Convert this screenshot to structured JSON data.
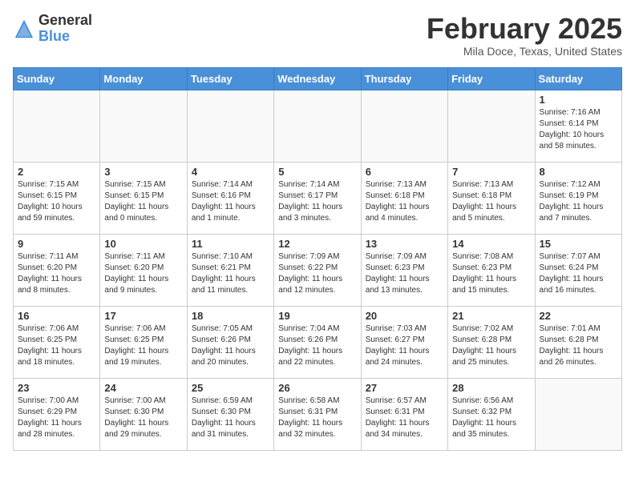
{
  "header": {
    "logo_general": "General",
    "logo_blue": "Blue",
    "month_title": "February 2025",
    "location": "Mila Doce, Texas, United States"
  },
  "days_of_week": [
    "Sunday",
    "Monday",
    "Tuesday",
    "Wednesday",
    "Thursday",
    "Friday",
    "Saturday"
  ],
  "weeks": [
    [
      {
        "day": "",
        "info": ""
      },
      {
        "day": "",
        "info": ""
      },
      {
        "day": "",
        "info": ""
      },
      {
        "day": "",
        "info": ""
      },
      {
        "day": "",
        "info": ""
      },
      {
        "day": "",
        "info": ""
      },
      {
        "day": "1",
        "info": "Sunrise: 7:16 AM\nSunset: 6:14 PM\nDaylight: 10 hours\nand 58 minutes."
      }
    ],
    [
      {
        "day": "2",
        "info": "Sunrise: 7:15 AM\nSunset: 6:15 PM\nDaylight: 10 hours\nand 59 minutes."
      },
      {
        "day": "3",
        "info": "Sunrise: 7:15 AM\nSunset: 6:15 PM\nDaylight: 11 hours\nand 0 minutes."
      },
      {
        "day": "4",
        "info": "Sunrise: 7:14 AM\nSunset: 6:16 PM\nDaylight: 11 hours\nand 1 minute."
      },
      {
        "day": "5",
        "info": "Sunrise: 7:14 AM\nSunset: 6:17 PM\nDaylight: 11 hours\nand 3 minutes."
      },
      {
        "day": "6",
        "info": "Sunrise: 7:13 AM\nSunset: 6:18 PM\nDaylight: 11 hours\nand 4 minutes."
      },
      {
        "day": "7",
        "info": "Sunrise: 7:13 AM\nSunset: 6:18 PM\nDaylight: 11 hours\nand 5 minutes."
      },
      {
        "day": "8",
        "info": "Sunrise: 7:12 AM\nSunset: 6:19 PM\nDaylight: 11 hours\nand 7 minutes."
      }
    ],
    [
      {
        "day": "9",
        "info": "Sunrise: 7:11 AM\nSunset: 6:20 PM\nDaylight: 11 hours\nand 8 minutes."
      },
      {
        "day": "10",
        "info": "Sunrise: 7:11 AM\nSunset: 6:20 PM\nDaylight: 11 hours\nand 9 minutes."
      },
      {
        "day": "11",
        "info": "Sunrise: 7:10 AM\nSunset: 6:21 PM\nDaylight: 11 hours\nand 11 minutes."
      },
      {
        "day": "12",
        "info": "Sunrise: 7:09 AM\nSunset: 6:22 PM\nDaylight: 11 hours\nand 12 minutes."
      },
      {
        "day": "13",
        "info": "Sunrise: 7:09 AM\nSunset: 6:23 PM\nDaylight: 11 hours\nand 13 minutes."
      },
      {
        "day": "14",
        "info": "Sunrise: 7:08 AM\nSunset: 6:23 PM\nDaylight: 11 hours\nand 15 minutes."
      },
      {
        "day": "15",
        "info": "Sunrise: 7:07 AM\nSunset: 6:24 PM\nDaylight: 11 hours\nand 16 minutes."
      }
    ],
    [
      {
        "day": "16",
        "info": "Sunrise: 7:06 AM\nSunset: 6:25 PM\nDaylight: 11 hours\nand 18 minutes."
      },
      {
        "day": "17",
        "info": "Sunrise: 7:06 AM\nSunset: 6:25 PM\nDaylight: 11 hours\nand 19 minutes."
      },
      {
        "day": "18",
        "info": "Sunrise: 7:05 AM\nSunset: 6:26 PM\nDaylight: 11 hours\nand 20 minutes."
      },
      {
        "day": "19",
        "info": "Sunrise: 7:04 AM\nSunset: 6:26 PM\nDaylight: 11 hours\nand 22 minutes."
      },
      {
        "day": "20",
        "info": "Sunrise: 7:03 AM\nSunset: 6:27 PM\nDaylight: 11 hours\nand 24 minutes."
      },
      {
        "day": "21",
        "info": "Sunrise: 7:02 AM\nSunset: 6:28 PM\nDaylight: 11 hours\nand 25 minutes."
      },
      {
        "day": "22",
        "info": "Sunrise: 7:01 AM\nSunset: 6:28 PM\nDaylight: 11 hours\nand 26 minutes."
      }
    ],
    [
      {
        "day": "23",
        "info": "Sunrise: 7:00 AM\nSunset: 6:29 PM\nDaylight: 11 hours\nand 28 minutes."
      },
      {
        "day": "24",
        "info": "Sunrise: 7:00 AM\nSunset: 6:30 PM\nDaylight: 11 hours\nand 29 minutes."
      },
      {
        "day": "25",
        "info": "Sunrise: 6:59 AM\nSunset: 6:30 PM\nDaylight: 11 hours\nand 31 minutes."
      },
      {
        "day": "26",
        "info": "Sunrise: 6:58 AM\nSunset: 6:31 PM\nDaylight: 11 hours\nand 32 minutes."
      },
      {
        "day": "27",
        "info": "Sunrise: 6:57 AM\nSunset: 6:31 PM\nDaylight: 11 hours\nand 34 minutes."
      },
      {
        "day": "28",
        "info": "Sunrise: 6:56 AM\nSunset: 6:32 PM\nDaylight: 11 hours\nand 35 minutes."
      },
      {
        "day": "",
        "info": ""
      }
    ]
  ]
}
